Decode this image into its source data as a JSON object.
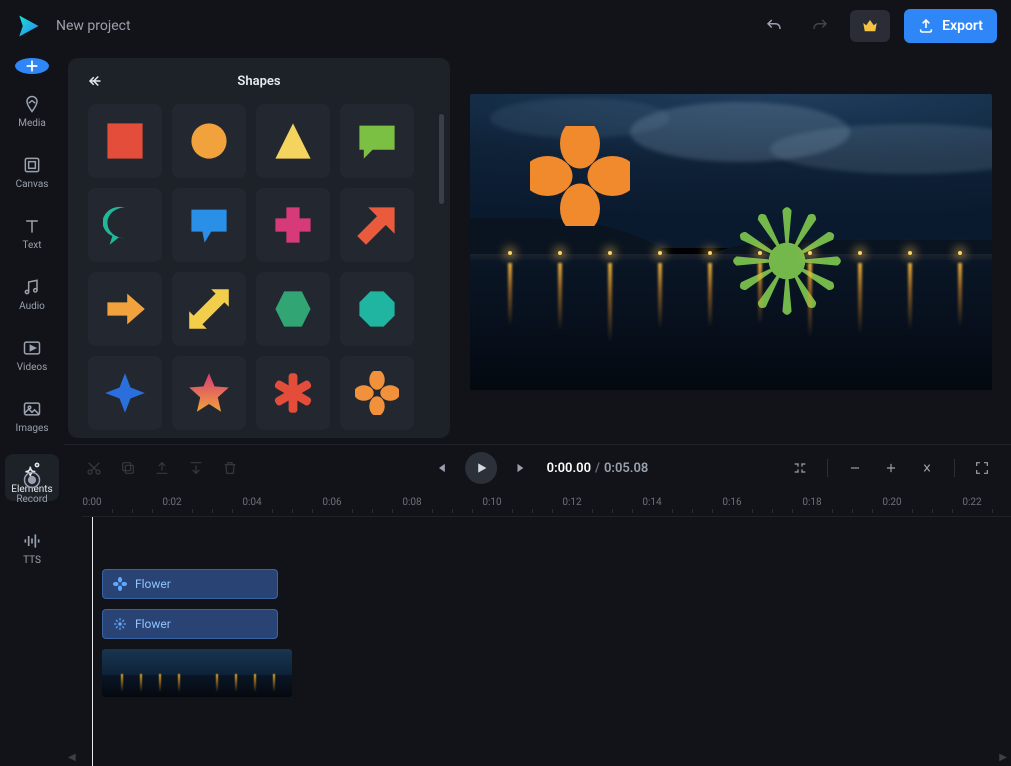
{
  "header": {
    "project_title": "New project",
    "export_label": "Export"
  },
  "rail": {
    "items": [
      {
        "id": "media",
        "label": "Media"
      },
      {
        "id": "canvas",
        "label": "Canvas"
      },
      {
        "id": "text",
        "label": "Text"
      },
      {
        "id": "audio",
        "label": "Audio"
      },
      {
        "id": "videos",
        "label": "Videos"
      },
      {
        "id": "images",
        "label": "Images"
      },
      {
        "id": "elements",
        "label": "Elements"
      },
      {
        "id": "record",
        "label": "Record"
      },
      {
        "id": "tts",
        "label": "TTS"
      }
    ],
    "active": "elements"
  },
  "panel": {
    "title": "Shapes",
    "shapes": [
      "square",
      "circle",
      "triangle",
      "speech-rect",
      "speech-round",
      "speech-box",
      "plus",
      "arrow-ne",
      "arrow-right",
      "arrow-diag",
      "hexagon",
      "octagon",
      "star4",
      "star5",
      "asterisk",
      "flower4"
    ]
  },
  "playback": {
    "current": "0:00.00",
    "duration": "0:05.08"
  },
  "ruler": {
    "ticks": [
      "0:00",
      "0:02",
      "0:04",
      "0:06",
      "0:08",
      "0:10",
      "0:12",
      "0:14",
      "0:16",
      "0:18",
      "0:20",
      "0:22"
    ]
  },
  "tracks": [
    {
      "type": "flower",
      "label": "Flower",
      "icon": "flower4-blue"
    },
    {
      "type": "flower",
      "label": "Flower",
      "icon": "burst-blue"
    }
  ],
  "colors": {
    "square": "#e44d3a",
    "circle": "#f2a23c",
    "triangle": "#f4d35e",
    "speech-rect": "#7bc043",
    "speech-round": "#1fb99a",
    "speech-box": "#2a8fe6",
    "plus": "#d73b77",
    "arrow-ne": "#ea5a3c",
    "arrow-right": "#f2a23c",
    "arrow-diag": "#f2ce4a",
    "hexagon": "#32a574",
    "octagon": "#1fb5a0",
    "star4": "#2a6fdc",
    "star5_a": "#d73b77",
    "star5_b": "#f2a23c",
    "asterisk": "#e44d3a",
    "flower4": "#f2913c"
  }
}
